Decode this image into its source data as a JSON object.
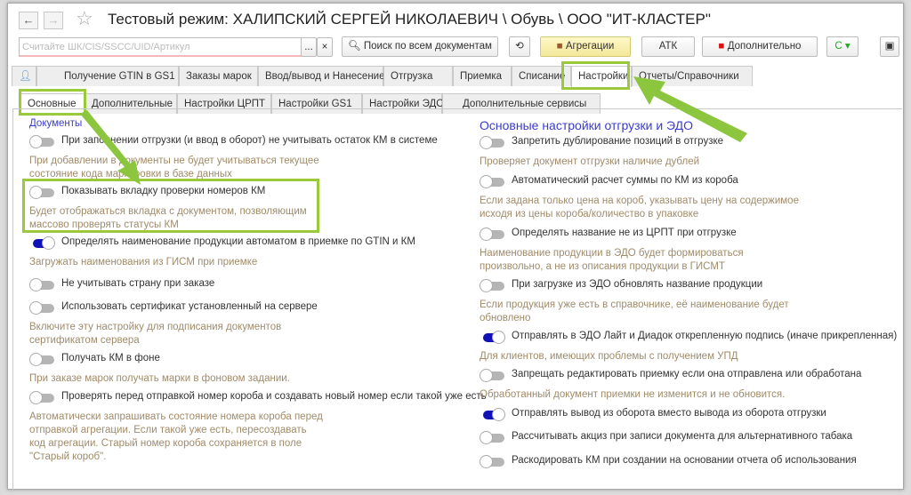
{
  "window": {
    "title": "Тестовый режим:  ХАЛИПСКИЙ СЕРГЕЙ НИКОЛАЕВИЧ \\ Обувь \\ ООО \"ИТ-КЛАСТЕР\"",
    "back": "←",
    "forward": "→",
    "star": "☆"
  },
  "toolbar": {
    "scan_placeholder": "Считайте ШК/CIS/SSCC/UID/Артикул",
    "more": "...",
    "clear": "×",
    "search_all": "Поиск по всем документам",
    "aggregation": "Агрегации",
    "atk": "АТК",
    "additional": "Дополнительно",
    "refresh": "C ▾"
  },
  "tabs": [
    "Получение GTIN в GS1",
    "Заказы марок",
    "Ввод/вывод и Нанесение",
    "Отгрузка",
    "Приемка",
    "Списание",
    "Настройки",
    "Отчеты/Справочники"
  ],
  "subtabs": [
    "Основные",
    "Дополнительные",
    "Настройки ЦРПТ",
    "Настройки GS1",
    "Настройки ЭДО",
    "Дополнительные сервисы"
  ],
  "left": {
    "section": "Документы",
    "items": [
      {
        "label": "При заполнении отгрузки (и ввод в оборот) не учитывать остаток КМ в системе",
        "on": false,
        "desc": "При добавлении в документы не будет учитываться текущее состояние кода маркировки в базе данных"
      },
      {
        "label": "Показывать вкладку проверки номеров КМ",
        "on": false,
        "desc": "Будет отображаться вкладка с документом, позволяющим массово проверять статусы КМ"
      },
      {
        "label": "Определять наименование продукции автоматом в приемке по GTIN и КМ",
        "on": true,
        "desc": "Загружать наименования из ГИСМ при приемке"
      },
      {
        "label": "Не учитывать страну при заказе",
        "on": false,
        "desc": ""
      },
      {
        "label": "Использовать сертификат установленный на сервере",
        "on": false,
        "desc": "Включите эту настройку для подписания документов сертификатом сервера"
      },
      {
        "label": "Получать КМ в фоне",
        "on": false,
        "desc": "При заказе марок получать марки в фоновом задании."
      },
      {
        "label": "Проверять перед отправкой номер короба и создавать новый номер если такой уже есть",
        "on": false,
        "desc": "Автоматически запрашивать состояние номера короба перед отправкой агрегации. Если такой уже есть, пересоздавать код агрегации. Старый номер короба сохраняется в поле \"Старый короб\"."
      }
    ]
  },
  "right": {
    "section": "Основные настройки отгрузки и ЭДО",
    "items": [
      {
        "label": "Запретить дублирование позиций в отгрузке",
        "on": false,
        "desc": "Проверяет документ отгрузки наличие дублей"
      },
      {
        "label": "Автоматический расчет суммы по КМ из короба",
        "on": false,
        "desc": "Если задана только цена на короб, указывать цену на содержимое исходя из цены короба/количество в упаковке"
      },
      {
        "label": "Определять название не из ЦРПТ при отгрузке",
        "on": false,
        "desc": "Наименование продукции в ЭДО будет формироваться произвольно, а не из описания продукции в ГИСМТ"
      },
      {
        "label": "При загрузке из ЭДО обновлять название продукции",
        "on": false,
        "desc": "Если продукция уже есть в справочнике, её наименование будет обновлено"
      },
      {
        "label": "Отправлять в ЭДО Лайт и Диадок открепленную подпись (иначе прикрепленная)",
        "on": true,
        "desc": "Для клиентов, имеющих проблемы с получением УПД"
      },
      {
        "label": "Запрещать редактировать приемку если она отправлена или обработана",
        "on": false,
        "desc": "Обработанный документ приемки не изменится и не обновится."
      },
      {
        "label": "Отправлять вывод из оборота вместо вывода из оборота отгрузки",
        "on": true,
        "desc": ""
      },
      {
        "label": "Рассчитывать акциз при записи документа для альтернативного табака",
        "on": false,
        "desc": ""
      },
      {
        "label": "Раскодировать КМ при создании на основании отчета об использования",
        "on": false,
        "desc": ""
      }
    ]
  },
  "colors": {
    "highlight": "#9bc93c",
    "toggle_on": "#1111b8",
    "section": "#3c3ccc",
    "desc": "#a08b6a"
  }
}
